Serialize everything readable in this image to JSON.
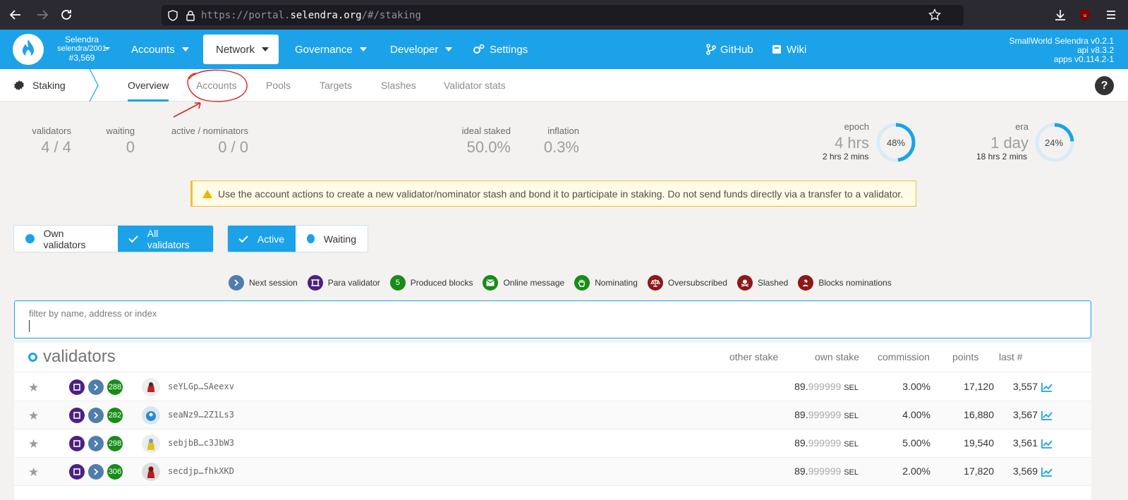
{
  "browser": {
    "url_prefix": "https://portal.",
    "url_domain": "selendra.org",
    "url_suffix": "/#/staking"
  },
  "header": {
    "chain_name": "Selendra",
    "chain_id": "selendra/2001",
    "block": "#3,569",
    "menu": [
      {
        "label": "Accounts",
        "caret": true
      },
      {
        "label": "Network",
        "caret": true,
        "active": true
      },
      {
        "label": "Governance",
        "caret": true
      },
      {
        "label": "Developer",
        "caret": true
      },
      {
        "label": "Settings",
        "caret": false
      }
    ],
    "github": "GitHub",
    "wiki": "Wiki",
    "version_lines": [
      "SmallWorld Selendra v0.2.1",
      "api v8.3.2",
      "apps v0.114.2-1"
    ]
  },
  "subnav": {
    "section": "Staking",
    "tabs": [
      "Overview",
      "Accounts",
      "Pools",
      "Targets",
      "Slashes",
      "Validator stats"
    ],
    "active_tab": "Overview",
    "help": "?"
  },
  "summary": {
    "validators_label": "validators",
    "validators_value": "4 / 4",
    "waiting_label": "waiting",
    "waiting_value": "0",
    "active_nominators_label": "active / nominators",
    "active_nominators_value": "0 / 0",
    "ideal_staked_label": "ideal staked",
    "ideal_staked_value": "50.0%",
    "inflation_label": "inflation",
    "inflation_value": "0.3%",
    "epoch_label": "epoch",
    "epoch_value": "4 hrs",
    "epoch_remaining": "2 hrs 2 mins",
    "epoch_percent": 48,
    "epoch_percent_text": "48%",
    "era_label": "era",
    "era_value": "1 day",
    "era_remaining": "18 hrs 2 mins",
    "era_percent": 24,
    "era_percent_text": "24%"
  },
  "warning": "Use the account actions to create a new validator/nominator stash and bond it to participate in staking. Do not send funds directly via a transfer to a validator.",
  "toggles": {
    "own_validators": "Own validators",
    "all_validators": "All validators",
    "active": "Active",
    "waiting": "Waiting"
  },
  "legend": [
    {
      "label": "Next session",
      "icon": "chevron-right-icon",
      "color": "#4f7dac"
    },
    {
      "label": "Para validator",
      "icon": "square-icon",
      "color": "#4b2181"
    },
    {
      "label": "Produced blocks",
      "icon": "count-5",
      "badge": "5",
      "color": "#188c18"
    },
    {
      "label": "Online message",
      "icon": "envelope-icon",
      "color": "#188c18"
    },
    {
      "label": "Nominating",
      "icon": "hand-icon",
      "color": "#188c18"
    },
    {
      "label": "Oversubscribed",
      "icon": "balance-scale-icon",
      "color": "#8c1818"
    },
    {
      "label": "Slashed",
      "icon": "skull-crossbones-icon",
      "color": "#8c1818"
    },
    {
      "label": "Blocks nominations",
      "icon": "user-slash-icon",
      "color": "#8c1818"
    }
  ],
  "filter": {
    "placeholder": "filter by name, address or index"
  },
  "table": {
    "title": "validators",
    "columns": [
      "other stake",
      "own stake",
      "commission",
      "points",
      "last #"
    ],
    "rows": [
      {
        "blocks": "288",
        "address": "seYLGp…SAeexv",
        "own_int": "89.",
        "own_dec": "999999",
        "unit": "SEL",
        "commission": "3.00%",
        "points": "17,120",
        "last": "3,557",
        "avatar_color": "#c02020"
      },
      {
        "blocks": "282",
        "address": "seaNz9…2Z1Ls3",
        "own_int": "89.",
        "own_dec": "999999",
        "unit": "SEL",
        "commission": "4.00%",
        "points": "16,880",
        "last": "3,567",
        "avatar_color": "#2a8ad0"
      },
      {
        "blocks": "298",
        "address": "sebjbB…c3JbW3",
        "own_int": "89.",
        "own_dec": "999999",
        "unit": "SEL",
        "commission": "5.00%",
        "points": "19,540",
        "last": "3,561",
        "avatar_color": "#e0c020"
      },
      {
        "blocks": "306",
        "address": "secdjp…fhkXKD",
        "own_int": "89.",
        "own_dec": "999999",
        "unit": "SEL",
        "commission": "2.00%",
        "points": "17,820",
        "last": "3,569",
        "avatar_color": "#b02020"
      }
    ]
  },
  "colors": {
    "accent": "#1ca2e8",
    "warning_border": "#f0c030",
    "annotation_red": "#e02020"
  }
}
